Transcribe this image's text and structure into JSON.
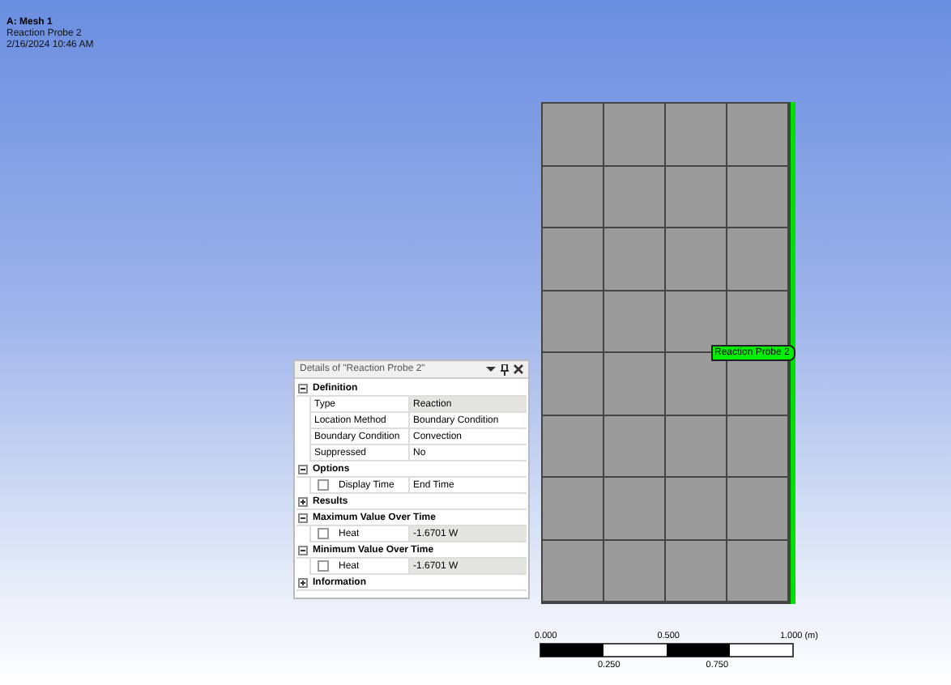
{
  "header": {
    "title": "A: Mesh 1",
    "subtitle": "Reaction Probe 2",
    "timestamp": "2/16/2024 10:46 AM"
  },
  "mesh": {
    "probe_label": "Reaction Probe 2"
  },
  "details": {
    "title": "Details of \"Reaction Probe 2\"",
    "rows": [
      {
        "kind": "section",
        "label": "Definition",
        "expanded": true
      },
      {
        "kind": "property",
        "label": "Type",
        "value": "Reaction",
        "readonly": true
      },
      {
        "kind": "property",
        "label": "Location Method",
        "value": "Boundary Condition",
        "readonly": false
      },
      {
        "kind": "property",
        "label": "Boundary Condition",
        "value": "Convection",
        "readonly": false
      },
      {
        "kind": "property",
        "label": "Suppressed",
        "value": "No",
        "readonly": false
      },
      {
        "kind": "section",
        "label": "Options",
        "expanded": true
      },
      {
        "kind": "check",
        "label": "Display Time",
        "value": "End Time",
        "readonly": false,
        "checked": false
      },
      {
        "kind": "section",
        "label": "Results",
        "expanded": false
      },
      {
        "kind": "section",
        "label": "Maximum Value Over Time",
        "expanded": true
      },
      {
        "kind": "check",
        "label": "Heat",
        "value": "-1.6701 W",
        "readonly": true,
        "checked": false
      },
      {
        "kind": "section",
        "label": "Minimum Value Over Time",
        "expanded": true
      },
      {
        "kind": "check",
        "label": "Heat",
        "value": "-1.6701 W",
        "readonly": true,
        "checked": false
      },
      {
        "kind": "section",
        "label": "Information",
        "expanded": false
      }
    ]
  },
  "scale": {
    "top_labels": [
      "0.000",
      "0.500",
      "1.000 (m)"
    ],
    "bottom_labels": [
      "0.250",
      "0.750"
    ]
  }
}
